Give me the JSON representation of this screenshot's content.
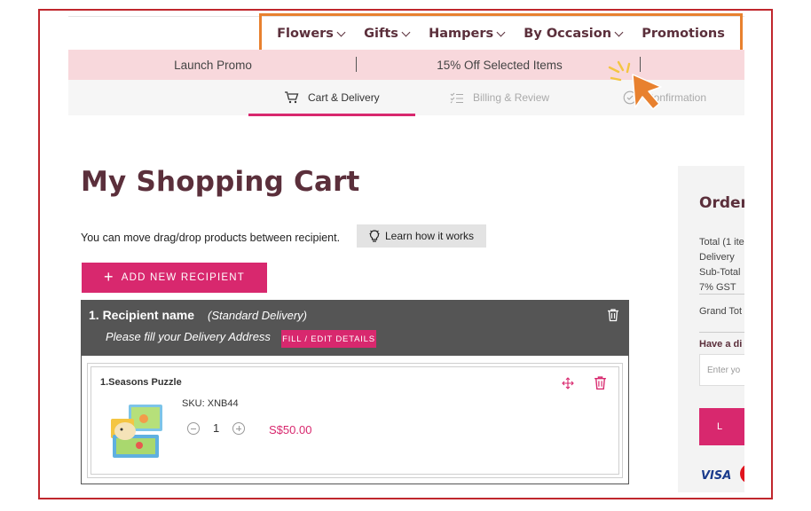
{
  "nav": {
    "items": [
      {
        "label": "Flowers"
      },
      {
        "label": "Gifts"
      },
      {
        "label": "Hampers"
      },
      {
        "label": "By Occasion"
      },
      {
        "label": "Promotions"
      }
    ]
  },
  "promo_bar": {
    "left": "Launch Promo",
    "middle": "15% Off Selected Items"
  },
  "steps": [
    {
      "label": "Cart & Delivery",
      "icon": "cart-icon",
      "active": true
    },
    {
      "label": "Billing & Review",
      "icon": "checklist-icon",
      "active": false
    },
    {
      "label": "Confirmation",
      "icon": "check-circle-icon",
      "active": false
    }
  ],
  "page": {
    "title": "My Shopping Cart",
    "hint": "You can move drag/drop products between recipient.",
    "learn_label": "Learn how it works",
    "add_recipient_label": "ADD NEW RECIPIENT"
  },
  "recipient": {
    "title": "1.  Recipient name",
    "delivery_type": "(Standard Delivery)",
    "fill_prompt": "Please fill your Delivery Address",
    "fill_button": "FILL / EDIT DETAILS",
    "item": {
      "name": "1.Seasons Puzzle",
      "sku": "SKU: XNB44",
      "quantity": "1",
      "price": "S$50.00"
    }
  },
  "order_summary": {
    "title": "Order",
    "total": "Total (1 ite",
    "delivery": "Delivery",
    "subtotal": "Sub-Total",
    "gst": "7% GST",
    "grand_total": "Grand Tot",
    "discount_prompt": "Have a di",
    "code_placeholder": "Enter yo",
    "apply_label": "L",
    "payment_visa": "VISA"
  },
  "colors": {
    "brand_pink": "#d8286e",
    "brand_plum": "#5b2f3b",
    "promo_bg": "#f8d8dc",
    "highlight_orange": "#e8812f",
    "frame_red": "#c0272d"
  }
}
